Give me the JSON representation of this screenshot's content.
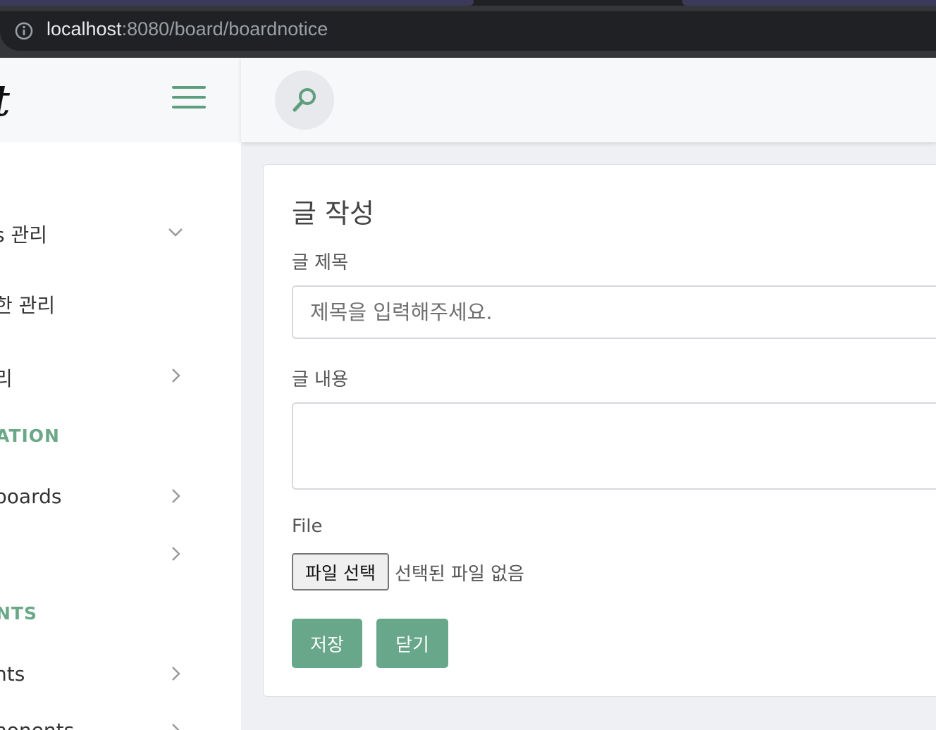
{
  "browser": {
    "url_host": "localhost",
    "url_rest": ":8080/board/boardnotice"
  },
  "sidebar": {
    "brand": "t",
    "items": [
      {
        "label": "s 관리",
        "chevron": "down"
      },
      {
        "label": "한 관리",
        "chevron": ""
      },
      {
        "label": "리",
        "chevron": "right"
      }
    ],
    "section1": "ATION",
    "section1_items": [
      {
        "label": "boards",
        "chevron": "right"
      },
      {
        "label": "",
        "chevron": "right"
      }
    ],
    "section2": "NTS",
    "section2_items": [
      {
        "label": "nts",
        "chevron": "right"
      },
      {
        "label": "nonents",
        "chevron": "right"
      }
    ]
  },
  "form": {
    "title": "글 작성",
    "subject_label": "글 제목",
    "subject_placeholder": "제목을 입력해주세요.",
    "content_label": "글 내용",
    "file_label": "File",
    "file_button": "파일 선택",
    "file_status": "선택된 파일 없음",
    "save_button": "저장",
    "close_button": "닫기"
  },
  "colors": {
    "accent": "#68a789",
    "section_head": "#6aa888",
    "chrome": "#202124"
  }
}
